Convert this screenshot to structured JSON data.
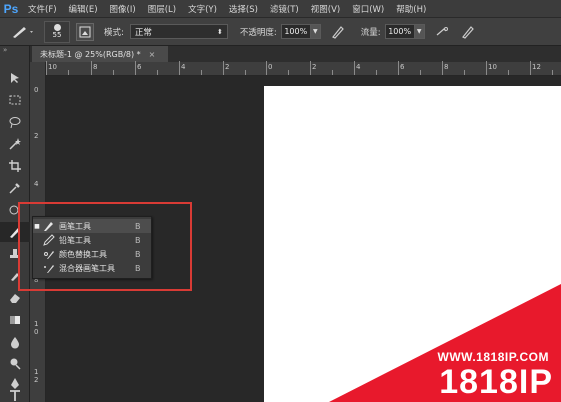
{
  "app": {
    "logo": "Ps"
  },
  "menu": [
    "文件(F)",
    "编辑(E)",
    "图像(I)",
    "图层(L)",
    "文字(Y)",
    "选择(S)",
    "滤镜(T)",
    "视图(V)",
    "窗口(W)",
    "帮助(H)"
  ],
  "options": {
    "brush_size": "55",
    "mode_label": "模式:",
    "mode_value": "正常",
    "opacity_label": "不透明度:",
    "opacity_value": "100%",
    "flow_label": "流量:",
    "flow_value": "100%"
  },
  "document": {
    "tab_title": "未标题-1 @ 25%(RGB/8) *",
    "close": "×"
  },
  "rulers": {
    "horizontal": [
      "10",
      "8",
      "6",
      "4",
      "2",
      "0",
      "2",
      "4",
      "6",
      "8",
      "10",
      "12"
    ],
    "vertical": [
      "0",
      "2",
      "4",
      "6",
      "8",
      "1\n0",
      "1\n2"
    ]
  },
  "flyout": {
    "items": [
      {
        "label": "画笔工具",
        "shortcut": "B",
        "selected": true
      },
      {
        "label": "铅笔工具",
        "shortcut": "B",
        "selected": false
      },
      {
        "label": "颜色替换工具",
        "shortcut": "B",
        "selected": false
      },
      {
        "label": "混合器画笔工具",
        "shortcut": "B",
        "selected": false
      }
    ]
  },
  "watermark": {
    "url": "WWW.1818IP.COM",
    "brand": "1818IP",
    "color": "#e8192c"
  },
  "colors": {
    "accent_highlight": "#d93b35",
    "ps_blue": "#4da6ff"
  },
  "icons": [
    "brush-icon",
    "image-icon",
    "airbrush-icon",
    "stylus-icon",
    "move-icon",
    "marquee-icon",
    "lasso-icon",
    "magic-wand-icon",
    "crop-icon",
    "eyedropper-icon",
    "healing-icon",
    "brush-icon",
    "stamp-icon",
    "history-brush-icon",
    "eraser-icon",
    "gradient-icon",
    "blur-icon",
    "dodge-icon",
    "pen-icon",
    "type-icon",
    "pencil-icon",
    "color-replace-icon",
    "mixer-brush-icon"
  ]
}
